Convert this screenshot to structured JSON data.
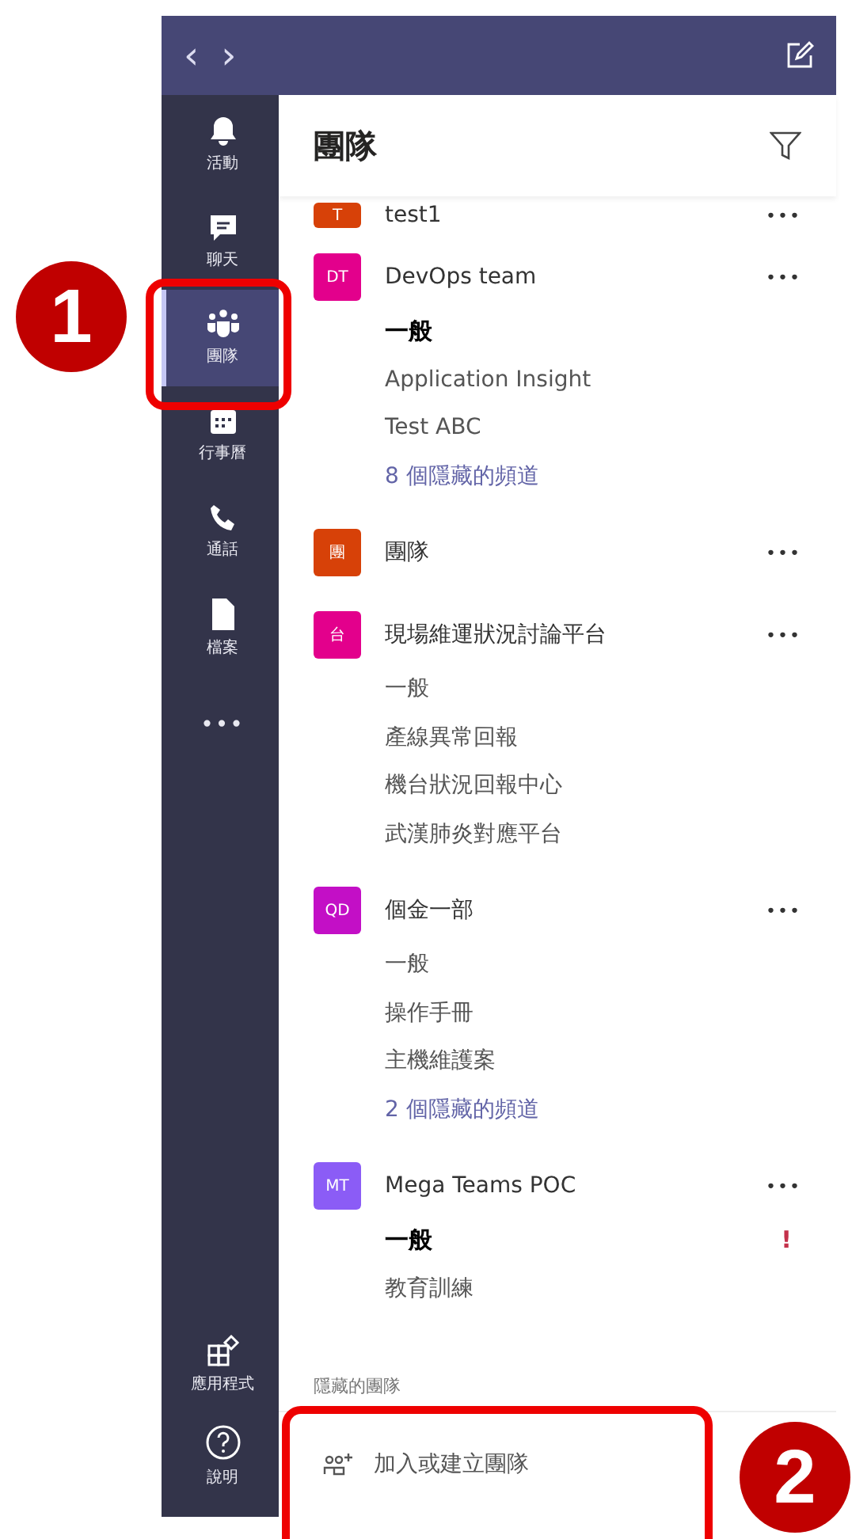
{
  "title_bar": {
    "back": "‹",
    "forward": "›"
  },
  "rail": [
    {
      "kind": "bell",
      "label": "活動",
      "selected": false
    },
    {
      "kind": "chat",
      "label": "聊天",
      "selected": false
    },
    {
      "kind": "teams",
      "label": "團隊",
      "selected": true
    },
    {
      "kind": "calendar",
      "label": "行事曆",
      "selected": false
    },
    {
      "kind": "phone",
      "label": "通話",
      "selected": false
    },
    {
      "kind": "file",
      "label": "檔案",
      "selected": false
    },
    {
      "kind": "more",
      "label": "•••",
      "selected": false
    }
  ],
  "rail_bottom": [
    {
      "kind": "apps",
      "label": "應用程式",
      "selected": false
    },
    {
      "kind": "help",
      "label": "說明",
      "selected": false
    }
  ],
  "header": {
    "title": "團隊"
  },
  "teams": [
    {
      "avatar": "T",
      "color": "#d74108",
      "name": "test1"
    },
    {
      "avatar": "DT",
      "color": "#e3008c",
      "name": "DevOps team",
      "channels": [
        {
          "kind": "channel",
          "name": "一般",
          "unread": true,
          "alert": false
        },
        {
          "kind": "channel",
          "name": "Application Insight",
          "unread": false,
          "alert": false
        },
        {
          "kind": "channel",
          "name": "Test ABC",
          "unread": false,
          "alert": false
        },
        {
          "kind": "hidden",
          "name": "8 個隱藏的頻道"
        }
      ]
    },
    {
      "avatar": "團",
      "color": "#d74108",
      "name": "團隊"
    },
    {
      "avatar": "台",
      "color": "#e3008c",
      "name": "現場維運狀況討論平台",
      "channels": [
        {
          "kind": "channel",
          "name": "一般",
          "unread": false,
          "alert": false
        },
        {
          "kind": "channel",
          "name": "產線異常回報",
          "unread": false,
          "alert": false
        },
        {
          "kind": "channel",
          "name": "機台狀況回報中心",
          "unread": false,
          "alert": false
        },
        {
          "kind": "channel",
          "name": "武漢肺炎對應平台",
          "unread": false,
          "alert": false
        }
      ]
    },
    {
      "avatar": "QD",
      "color": "#c30fc6",
      "name": "個金一部",
      "channels": [
        {
          "kind": "channel",
          "name": "一般",
          "unread": false,
          "alert": false
        },
        {
          "kind": "channel",
          "name": "操作手冊",
          "unread": false,
          "alert": false
        },
        {
          "kind": "channel",
          "name": "主機維護案",
          "unread": false,
          "alert": false
        },
        {
          "kind": "hidden",
          "name": "2 個隱藏的頻道"
        }
      ]
    },
    {
      "avatar": "MT",
      "color": "#8b5cf6",
      "name": "Mega Teams POC",
      "channels": [
        {
          "kind": "channel",
          "name": "一般",
          "unread": true,
          "alert": true
        },
        {
          "kind": "channel",
          "name": "教育訓練",
          "unread": false,
          "alert": false
        }
      ]
    }
  ],
  "more_label": "•••",
  "alert_mark": "!",
  "hidden_teams": "隱藏的團隊",
  "join_button": "加入或建立團隊",
  "callouts": [
    "1",
    "2"
  ]
}
